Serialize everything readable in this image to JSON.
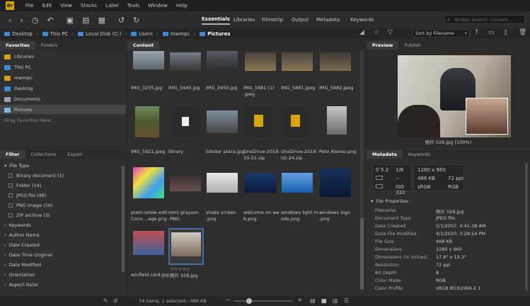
{
  "menu": {
    "logo": "Br",
    "items": [
      "File",
      "Edit",
      "View",
      "Stacks",
      "Label",
      "Tools",
      "Window",
      "Help"
    ]
  },
  "workspaces": [
    "Essentials",
    "Libraries",
    "Filmstrip",
    "Output",
    "Metadata",
    "Keywords"
  ],
  "search_placeholder": "Bridge Search: Current...",
  "path": [
    "Desktop",
    "This PC",
    "Local Disk (C:)",
    "Users",
    "mwmpc",
    "Pictures"
  ],
  "sort_label": "Sort by Filename",
  "favorites": {
    "tabs": [
      "Favorites",
      "Folders"
    ],
    "items": [
      "Libraries",
      "This PC",
      "mwmpc",
      "Desktop",
      "Documents",
      "Pictures"
    ],
    "hint": "Drag Favorites Here..."
  },
  "filter": {
    "tabs": [
      "Filter",
      "Collections",
      "Export"
    ],
    "file_type": "File Type",
    "types": [
      "Binary document (1)",
      "Folder (14)",
      "JPEG file (48)",
      "PNG image (16)",
      "ZIP archive (3)"
    ],
    "groups": [
      "Keywords",
      "Author Name",
      "Date Created",
      "Date Time Original",
      "Date Modified",
      "Orientation",
      "Aspect Ratio"
    ]
  },
  "content": {
    "tab": "Content",
    "row1": [
      "IMG_3235.jpg",
      "IMG_3440.jpg",
      "IMG_3450.jpg",
      "IMG_5881 (1)\n.jpeg",
      "IMG_5881.jpeg",
      "IMG_5882.jpeg"
    ],
    "row2": [
      "IMG_5921.jpeg",
      "library",
      "lobster place.jpg",
      "OneDrive-2018-\n10-31.zip",
      "OneDrive-2019-\n02-24.zip",
      "Pete Alonso.png"
    ],
    "row3": [
      "prem-smile-edit-\nConv....age.png",
      "remi grayson\n.PNG",
      "shake screen\n.png",
      "welcome on we\nb.png",
      "windows light m\node.png",
      "windows logo\n.png"
    ],
    "row4": [
      "winfield card.jpg",
      "☆☆☆☆☆\n照片 026.jpg"
    ]
  },
  "preview": {
    "tabs": [
      "Preview",
      "Publish"
    ],
    "caption": "照片 026.jpg (100%)"
  },
  "metadata": {
    "tabs": [
      "Metadata",
      "Keywords"
    ],
    "aperture": "f/ 5.2",
    "shutter": "1/8",
    "dims": "1280 x 960",
    "size": "488 KB",
    "ppi": "72 ppi",
    "cs": "sRGB",
    "mode": "RGB",
    "dash": "--",
    "iso": "ISO 320",
    "section": "File Properties",
    "rows": [
      [
        "Filename",
        "照片 026.jpg"
      ],
      [
        "Document Type",
        "JPEG file"
      ],
      [
        "Date Created",
        "5/1/2007, 4:41:38 AM"
      ],
      [
        "Date File Modified",
        "4/1/2020, 3:28:54 PM"
      ],
      [
        "File Size",
        "488 KB"
      ],
      [
        "Dimensions",
        "1280 x 960"
      ],
      [
        "Dimensions (in inches)",
        "17.8\" x 13.3\""
      ],
      [
        "Resolution",
        "72 ppi"
      ],
      [
        "Bit Depth",
        "8"
      ],
      [
        "Color Mode",
        "RGB"
      ],
      [
        "Color Profile",
        "sRGB IEC61966-2.1"
      ]
    ]
  },
  "status": "74 items, 1 selected - 488 KB"
}
